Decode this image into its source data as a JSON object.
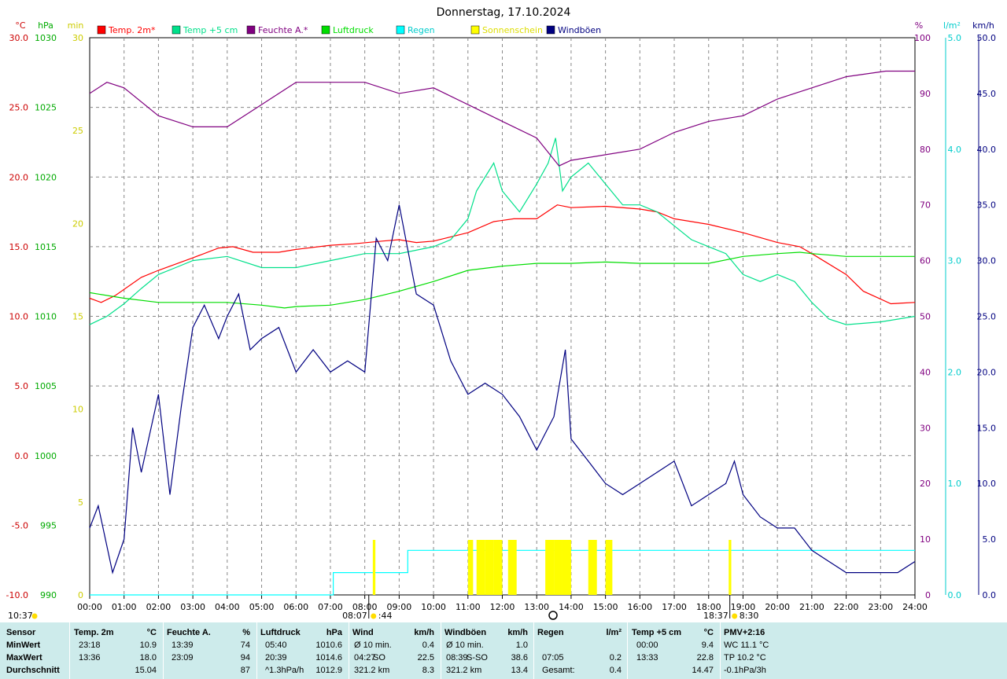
{
  "title": "Donnerstag, 17.10.2024",
  "axes": {
    "celsius_unit": "°C",
    "hpa_unit": "hPa",
    "min_unit": "min",
    "pct_unit": "%",
    "rain_unit": "l/m²",
    "kmh_unit": "km/h",
    "celsius_ticks": [
      "30.0",
      "25.0",
      "20.0",
      "15.0",
      "10.0",
      "5.0",
      "0.0",
      "-5.0",
      "-10.0"
    ],
    "hpa_ticks": [
      "1030",
      "1025",
      "1020",
      "1015",
      "1010",
      "1005",
      "1000",
      "995",
      "990"
    ],
    "min_ticks": [
      "30",
      "25",
      "20",
      "15",
      "10",
      "5",
      "0"
    ],
    "pct_ticks": [
      "100",
      "90",
      "80",
      "70",
      "60",
      "50",
      "40",
      "30",
      "20",
      "10",
      "0"
    ],
    "rain_ticks": [
      "5.0",
      "4.0",
      "3.0",
      "2.0",
      "1.0",
      "0.0"
    ],
    "kmh_ticks": [
      "50.0",
      "45.0",
      "40.0",
      "35.0",
      "30.0",
      "25.0",
      "20.0",
      "15.0",
      "10.0",
      "5.0",
      "0.0"
    ],
    "hour_ticks": [
      "00:00",
      "01:00",
      "02:00",
      "03:00",
      "04:00",
      "05:00",
      "06:00",
      "07:00",
      "08:00",
      "09:00",
      "10:00",
      "11:00",
      "12:00",
      "13:00",
      "14:00",
      "15:00",
      "16:00",
      "17:00",
      "18:00",
      "19:00",
      "20:00",
      "21:00",
      "22:00",
      "23:00",
      "24:00"
    ]
  },
  "sun": {
    "sunrise": "08:07",
    "sunrise_end": ":44",
    "sunset": "18:37",
    "sunset_end": "8:30",
    "daylength": "10:37"
  },
  "colors": {
    "temp": "#ff0000",
    "temp5": "#00e08a",
    "hum": "#800080",
    "press": "#00dd00",
    "rain": "#00ffff",
    "sun": "#ffff00",
    "gust": "#000080"
  },
  "chart_data": {
    "type": "line",
    "title": "Donnerstag, 17.10.2024",
    "x_range": [
      "00:00",
      "24:00"
    ],
    "legend_position": "top",
    "grid": true,
    "series": [
      {
        "name": "Temp. 2m*",
        "unit": "°C",
        "axis": "°C",
        "ylim": [
          -10,
          30
        ],
        "points": [
          [
            "00:00",
            11.3
          ],
          [
            "00:20",
            11.0
          ],
          [
            "00:45",
            11.5
          ],
          [
            "01:30",
            12.8
          ],
          [
            "02:00",
            13.3
          ],
          [
            "03:00",
            14.2
          ],
          [
            "03:45",
            14.9
          ],
          [
            "04:10",
            15.0
          ],
          [
            "04:45",
            14.6
          ],
          [
            "05:30",
            14.6
          ],
          [
            "06:00",
            14.8
          ],
          [
            "07:00",
            15.1
          ],
          [
            "07:40",
            15.2
          ],
          [
            "08:30",
            15.4
          ],
          [
            "09:00",
            15.5
          ],
          [
            "09:30",
            15.3
          ],
          [
            "10:00",
            15.4
          ],
          [
            "11:00",
            16.0
          ],
          [
            "11:45",
            16.8
          ],
          [
            "12:20",
            17.0
          ],
          [
            "13:00",
            17.0
          ],
          [
            "13:36",
            18.0
          ],
          [
            "14:00",
            17.8
          ],
          [
            "15:00",
            17.9
          ],
          [
            "16:00",
            17.7
          ],
          [
            "16:30",
            17.5
          ],
          [
            "17:00",
            17.0
          ],
          [
            "18:00",
            16.6
          ],
          [
            "19:00",
            16.0
          ],
          [
            "20:00",
            15.3
          ],
          [
            "20:39",
            15.0
          ],
          [
            "21:00",
            14.5
          ],
          [
            "22:00",
            13.0
          ],
          [
            "22:30",
            11.8
          ],
          [
            "23:18",
            10.9
          ],
          [
            "24:00",
            11.0
          ]
        ]
      },
      {
        "name": "Temp +5 cm",
        "unit": "°C",
        "axis": "°C",
        "ylim": [
          -10,
          30
        ],
        "points": [
          [
            "00:00",
            9.4
          ],
          [
            "00:30",
            10.0
          ],
          [
            "01:00",
            10.9
          ],
          [
            "01:30",
            12.0
          ],
          [
            "02:00",
            13.0
          ],
          [
            "02:30",
            13.5
          ],
          [
            "03:00",
            14.0
          ],
          [
            "04:00",
            14.3
          ],
          [
            "05:00",
            13.5
          ],
          [
            "06:00",
            13.5
          ],
          [
            "07:00",
            14.0
          ],
          [
            "08:00",
            14.5
          ],
          [
            "08:30",
            14.5
          ],
          [
            "09:00",
            14.5
          ],
          [
            "10:00",
            15.0
          ],
          [
            "10:30",
            15.5
          ],
          [
            "11:00",
            17.0
          ],
          [
            "11:15",
            19.0
          ],
          [
            "11:45",
            21.0
          ],
          [
            "12:00",
            19.0
          ],
          [
            "12:30",
            17.5
          ],
          [
            "13:00",
            19.5
          ],
          [
            "13:20",
            21.0
          ],
          [
            "13:33",
            22.8
          ],
          [
            "13:45",
            19.0
          ],
          [
            "14:00",
            20.0
          ],
          [
            "14:30",
            21.0
          ],
          [
            "15:00",
            19.5
          ],
          [
            "15:30",
            18.0
          ],
          [
            "16:00",
            18.0
          ],
          [
            "16:30",
            17.5
          ],
          [
            "17:00",
            16.5
          ],
          [
            "17:30",
            15.5
          ],
          [
            "18:00",
            15.0
          ],
          [
            "18:30",
            14.5
          ],
          [
            "19:00",
            13.0
          ],
          [
            "19:30",
            12.5
          ],
          [
            "20:00",
            13.0
          ],
          [
            "20:30",
            12.5
          ],
          [
            "21:00",
            11.0
          ],
          [
            "21:30",
            9.8
          ],
          [
            "22:00",
            9.4
          ],
          [
            "23:00",
            9.6
          ],
          [
            "24:00",
            10.0
          ]
        ]
      },
      {
        "name": "Feuchte A.*",
        "unit": "%",
        "axis": "%",
        "ylim": [
          0,
          100
        ],
        "points": [
          [
            "00:00",
            90
          ],
          [
            "00:30",
            92
          ],
          [
            "01:00",
            91
          ],
          [
            "02:00",
            86
          ],
          [
            "03:00",
            84
          ],
          [
            "04:00",
            84
          ],
          [
            "05:00",
            88
          ],
          [
            "06:00",
            92
          ],
          [
            "07:00",
            92
          ],
          [
            "08:00",
            92
          ],
          [
            "09:00",
            90
          ],
          [
            "10:00",
            91
          ],
          [
            "11:00",
            88
          ],
          [
            "12:00",
            85
          ],
          [
            "13:00",
            82
          ],
          [
            "13:39",
            77
          ],
          [
            "14:00",
            78
          ],
          [
            "15:00",
            79
          ],
          [
            "16:00",
            80
          ],
          [
            "17:00",
            83
          ],
          [
            "18:00",
            85
          ],
          [
            "19:00",
            86
          ],
          [
            "20:00",
            89
          ],
          [
            "21:00",
            91
          ],
          [
            "22:00",
            93
          ],
          [
            "23:09",
            94
          ],
          [
            "24:00",
            94
          ]
        ]
      },
      {
        "name": "Luftdruck",
        "unit": "hPa",
        "axis": "hPa",
        "ylim": [
          990,
          1030
        ],
        "points": [
          [
            "00:00",
            1011.7
          ],
          [
            "01:00",
            1011.3
          ],
          [
            "02:00",
            1011.0
          ],
          [
            "03:00",
            1011.0
          ],
          [
            "04:00",
            1011.0
          ],
          [
            "05:00",
            1010.8
          ],
          [
            "05:40",
            1010.6
          ],
          [
            "06:00",
            1010.7
          ],
          [
            "07:00",
            1010.8
          ],
          [
            "08:00",
            1011.2
          ],
          [
            "09:00",
            1011.8
          ],
          [
            "10:00",
            1012.5
          ],
          [
            "11:00",
            1013.3
          ],
          [
            "12:00",
            1013.6
          ],
          [
            "13:00",
            1013.8
          ],
          [
            "14:00",
            1013.8
          ],
          [
            "15:00",
            1013.9
          ],
          [
            "16:00",
            1013.8
          ],
          [
            "17:00",
            1013.8
          ],
          [
            "18:00",
            1013.8
          ],
          [
            "19:00",
            1014.3
          ],
          [
            "20:00",
            1014.5
          ],
          [
            "20:39",
            1014.6
          ],
          [
            "21:00",
            1014.5
          ],
          [
            "22:00",
            1014.3
          ],
          [
            "23:00",
            1014.3
          ],
          [
            "24:00",
            1014.3
          ]
        ]
      },
      {
        "name": "Regen",
        "unit": "l/m²",
        "axis": "l/m²",
        "ylim": [
          0,
          5
        ],
        "points": [
          [
            "00:00",
            0
          ],
          [
            "07:05",
            0
          ],
          [
            "07:05",
            0.2
          ],
          [
            "09:15",
            0.2
          ],
          [
            "09:15",
            0.4
          ],
          [
            "24:00",
            0.4
          ]
        ]
      },
      {
        "name": "Sonnenschein",
        "unit": "min",
        "axis": "min",
        "ylim": [
          0,
          30
        ],
        "intervals": [
          [
            "08:14",
            0.5
          ],
          [
            "11:00",
            2
          ],
          [
            "11:15",
            5
          ],
          [
            "11:30",
            5
          ],
          [
            "11:45",
            5
          ],
          [
            "12:10",
            4
          ],
          [
            "13:15",
            4
          ],
          [
            "13:30",
            5
          ],
          [
            "13:45",
            5
          ],
          [
            "14:30",
            4
          ],
          [
            "15:00",
            3
          ],
          [
            "18:35",
            0.5
          ]
        ]
      },
      {
        "name": "Windböen",
        "unit": "km/h",
        "axis": "km/h",
        "ylim": [
          0,
          50
        ],
        "points": [
          [
            "00:00",
            6
          ],
          [
            "00:15",
            8
          ],
          [
            "00:40",
            2
          ],
          [
            "01:00",
            5
          ],
          [
            "01:15",
            15
          ],
          [
            "01:30",
            11
          ],
          [
            "02:00",
            18
          ],
          [
            "02:20",
            9
          ],
          [
            "02:40",
            17
          ],
          [
            "03:00",
            24
          ],
          [
            "03:20",
            26
          ],
          [
            "03:45",
            23
          ],
          [
            "04:00",
            25
          ],
          [
            "04:20",
            27
          ],
          [
            "04:40",
            22
          ],
          [
            "05:00",
            23
          ],
          [
            "05:30",
            24
          ],
          [
            "06:00",
            20
          ],
          [
            "06:30",
            22
          ],
          [
            "07:00",
            20
          ],
          [
            "07:30",
            21
          ],
          [
            "08:00",
            20
          ],
          [
            "08:20",
            32
          ],
          [
            "08:40",
            30
          ],
          [
            "09:00",
            35
          ],
          [
            "09:30",
            27
          ],
          [
            "10:00",
            26
          ],
          [
            "10:30",
            21
          ],
          [
            "11:00",
            18
          ],
          [
            "11:30",
            19
          ],
          [
            "12:00",
            18
          ],
          [
            "12:30",
            16
          ],
          [
            "13:00",
            13
          ],
          [
            "13:30",
            16
          ],
          [
            "13:50",
            22
          ],
          [
            "14:00",
            14
          ],
          [
            "14:30",
            12
          ],
          [
            "15:00",
            10
          ],
          [
            "15:30",
            9
          ],
          [
            "16:00",
            10
          ],
          [
            "16:30",
            11
          ],
          [
            "17:00",
            12
          ],
          [
            "17:30",
            8
          ],
          [
            "18:00",
            9
          ],
          [
            "18:30",
            10
          ],
          [
            "18:45",
            12
          ],
          [
            "19:00",
            9
          ],
          [
            "19:30",
            7
          ],
          [
            "20:00",
            6
          ],
          [
            "20:30",
            6
          ],
          [
            "21:00",
            4
          ],
          [
            "21:30",
            3
          ],
          [
            "22:00",
            2
          ],
          [
            "22:30",
            2
          ],
          [
            "23:00",
            2
          ],
          [
            "23:30",
            2
          ],
          [
            "24:00",
            3
          ]
        ]
      }
    ]
  },
  "stats": {
    "headers": [
      {
        "label": "Sensor",
        "unit": ""
      },
      {
        "label": "Temp. 2m",
        "unit": "°C"
      },
      {
        "label": "Feuchte A.",
        "unit": "%"
      },
      {
        "label": "Luftdruck",
        "unit": "hPa"
      },
      {
        "label": "Wind",
        "unit": "km/h"
      },
      {
        "label": "Windböen",
        "unit": "km/h"
      },
      {
        "label": "Regen",
        "unit": "l/m²"
      },
      {
        "label": "Temp +5 cm",
        "unit": "°C"
      },
      {
        "label": "PMV+2:16",
        "unit": ""
      }
    ],
    "row_labels": [
      "MinWert",
      "MaxWert",
      "Durchschnitt"
    ],
    "temp2m": [
      [
        "23:18",
        "10.9"
      ],
      [
        "13:36",
        "18.0"
      ],
      [
        "",
        "15.04"
      ]
    ],
    "hum": [
      [
        "13:39",
        "74"
      ],
      [
        "23:09",
        "94"
      ],
      [
        "",
        "87"
      ]
    ],
    "press": [
      [
        "05:40",
        "1010.6"
      ],
      [
        "20:39",
        "1014.6"
      ],
      [
        "^1.3hPa/h",
        "1012.9"
      ]
    ],
    "wind": [
      [
        "Ø 10 min.",
        "",
        "0.4"
      ],
      [
        "04:27",
        "SO",
        "22.5"
      ],
      [
        "321.2 km",
        "",
        "8.3"
      ]
    ],
    "gust": [
      [
        "Ø 10 min.",
        "",
        "1.0"
      ],
      [
        "08:39",
        "S-SO",
        "38.6"
      ],
      [
        "321.2 km",
        "",
        "13.4"
      ]
    ],
    "rain": [
      [
        "",
        ""
      ],
      [
        "07:05",
        "0.2"
      ],
      [
        "Gesamt:",
        "0.4"
      ]
    ],
    "temp5": [
      [
        "00:00",
        "9.4"
      ],
      [
        "13:33",
        "22.8"
      ],
      [
        "",
        "14.47"
      ]
    ],
    "pmv": [
      "WC 11.1 °C",
      "TP 10.2 °C",
      "-0.1hPa/3h"
    ]
  }
}
